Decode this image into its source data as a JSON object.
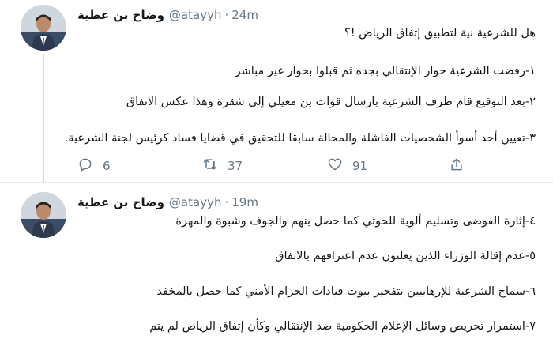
{
  "tweets": [
    {
      "author": "وضاح بن عطية",
      "handle": "@atayyh",
      "separator": "·",
      "time": "24m",
      "lines": [
        "هل للشرعية نية لتطبيق إتفاق الرياض !؟",
        "١-رفضت الشرعية حوار الإنتقالي بجده ثم قبلوا بحوار غير مباشر",
        "٢-بعد التوقيع قام طرف الشرعية بارسال قوات بن معيلي إلى شقرة وهذا عكس الاتفاق",
        "٣-تعيين أحد أسوأ الشخصيات الفاشلة والمحالة سابقا للتحقيق في قضايا فساد كرئيس لجنة الشرعية."
      ],
      "actions": {
        "reply_count": "6",
        "retweet_count": "37",
        "like_count": "91"
      }
    },
    {
      "author": "وضاح بن عطية",
      "handle": "@atayyh",
      "separator": "·",
      "time": "19m",
      "lines": [
        "٤-إثارة الفوضى وتسليم ألوية للحوثي كما حصل بنهم والجوف وشبوة والمهرة",
        "٥-عدم إقالة الوزراء الذين يعلنون عدم اعترافهم بالاتفاق",
        "٦-سماح الشرعية للإرهابيين بتفجير بيوت قيادات الحزام الأمني كما حصل بالمخفد",
        "٧-استمرار تحريض وسائل الإعلام الحكومية ضد الإنتقالي وكأن إتفاق الرياض لم يتم"
      ]
    }
  ],
  "icons": {
    "reply": "reply-icon",
    "retweet": "retweet-icon",
    "like": "heart-icon",
    "share": "share-icon"
  },
  "colors": {
    "text": "#14171a",
    "secondary": "#657786",
    "divider": "#e6ecf0"
  }
}
